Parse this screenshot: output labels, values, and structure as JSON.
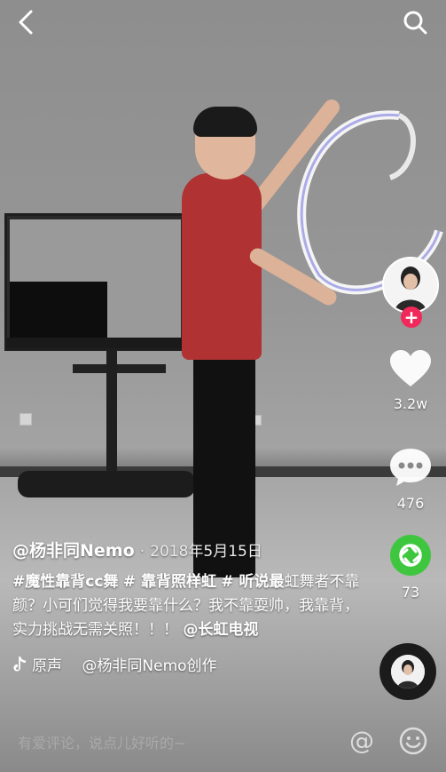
{
  "video": {
    "author": "@杨非同Nemo",
    "date_sep": "·",
    "date": "2018年5月15日",
    "caption_tag1": "#魔性靠背cc舞",
    "caption_tag2": "# 靠背照样虹",
    "caption_tag3": "# 听说最",
    "caption_text": "虹舞者不靠颜？小可们觉得我要靠什么？我不靠耍帅，我靠背，实力挑战无需关照！！！",
    "caption_mention": "@长虹电视"
  },
  "music": {
    "icon": "tiktok-note-icon",
    "text": "原声　 @杨非同Nemo创作"
  },
  "actions": {
    "likes": "3.2w",
    "comments": "476",
    "shares": "73"
  },
  "comment_bar": {
    "placeholder": "有爱评论，说点儿好听的~",
    "at_symbol": "@"
  },
  "colors": {
    "follow": "#f0295a",
    "share_green": "#3ec73e",
    "shirt": "#b03232"
  }
}
